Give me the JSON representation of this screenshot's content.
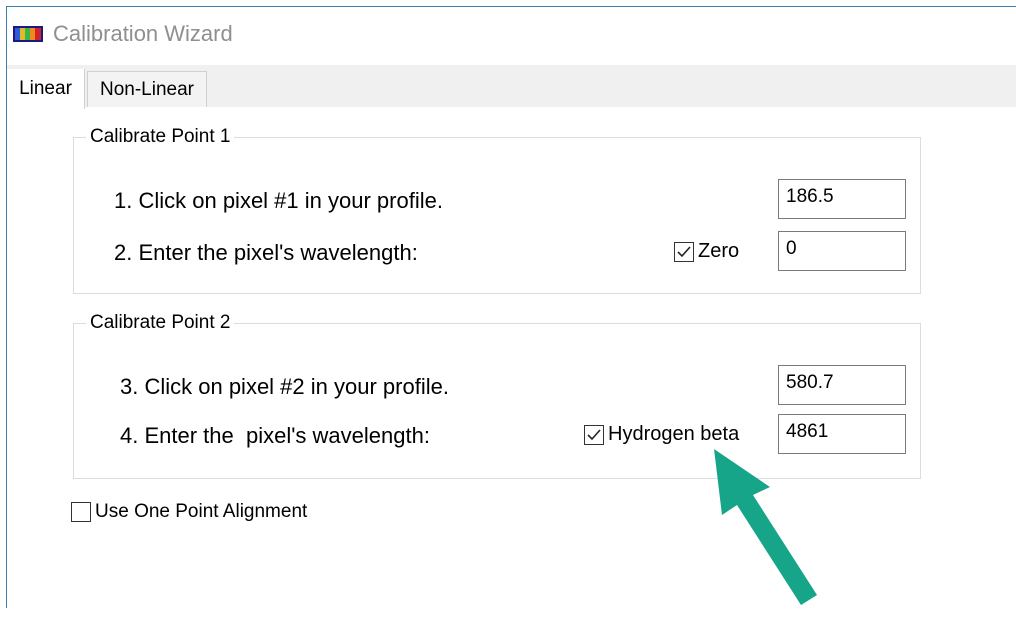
{
  "window": {
    "title": "Calibration Wizard",
    "icon": "spectrum-icon"
  },
  "tabs": [
    {
      "label": "Linear",
      "active": true
    },
    {
      "label": "Non-Linear",
      "active": false
    }
  ],
  "point1": {
    "legend": "Calibrate Point 1",
    "step1_label": "1. Click on pixel #1 in your profile.",
    "step1_value": "186.5",
    "step2_label": "2. Enter the pixel's wavelength:",
    "checkbox_label": "Zero",
    "checkbox_checked": true,
    "step2_value": "0"
  },
  "point2": {
    "legend": "Calibrate Point 2",
    "step3_label": "3. Click on pixel #2 in your profile.",
    "step3_value": "580.7",
    "step4_label": "4. Enter the  pixel's wavelength:",
    "checkbox_label": "Hydrogen beta",
    "checkbox_checked": true,
    "step4_value": "4861"
  },
  "one_point": {
    "label": "Use One Point Alignment",
    "checked": false
  },
  "annotation": {
    "arrow_color": "#17a589"
  }
}
